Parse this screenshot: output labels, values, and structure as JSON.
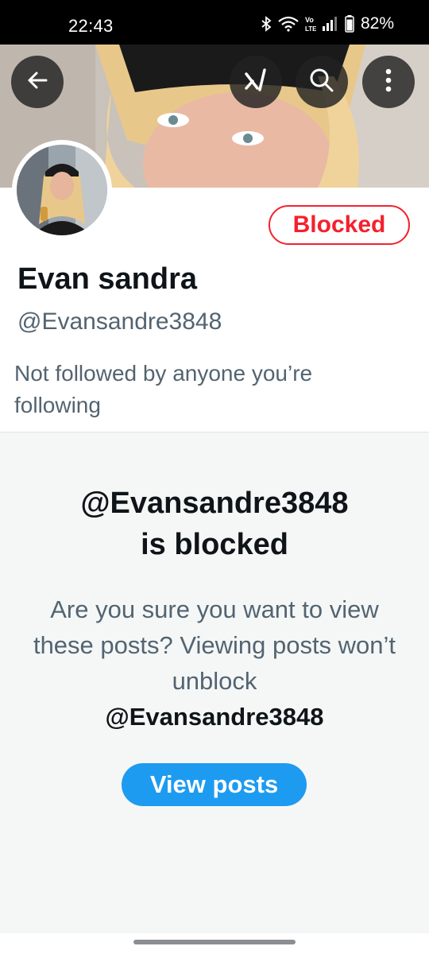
{
  "status_bar": {
    "time": "22:43",
    "battery": "82%",
    "icons": [
      "bluetooth-icon",
      "wifi-icon",
      "volte-icon",
      "signal-icon",
      "battery-icon"
    ]
  },
  "header": {
    "back_icon": "arrow-left-icon",
    "grok_icon": "grok-icon",
    "search_icon": "search-icon",
    "more_icon": "more-vertical-icon"
  },
  "profile": {
    "name": "Evan sandra",
    "handle": "@Evansandre3848",
    "followers_note": "Not followed by anyone you’re following",
    "blocked_label": "Blocked"
  },
  "blocked_notice": {
    "title_line1": "@Evansandre3848",
    "title_line2": "is blocked",
    "message": "Are you sure you want to view these posts? Viewing posts won’t unblock",
    "message_handle": "@Evansandre3848",
    "view_posts_label": "View posts"
  },
  "colors": {
    "accent": "#1d9bf0",
    "blocked": "#f4212e",
    "text_primary": "#0f1419",
    "text_secondary": "#536471"
  }
}
